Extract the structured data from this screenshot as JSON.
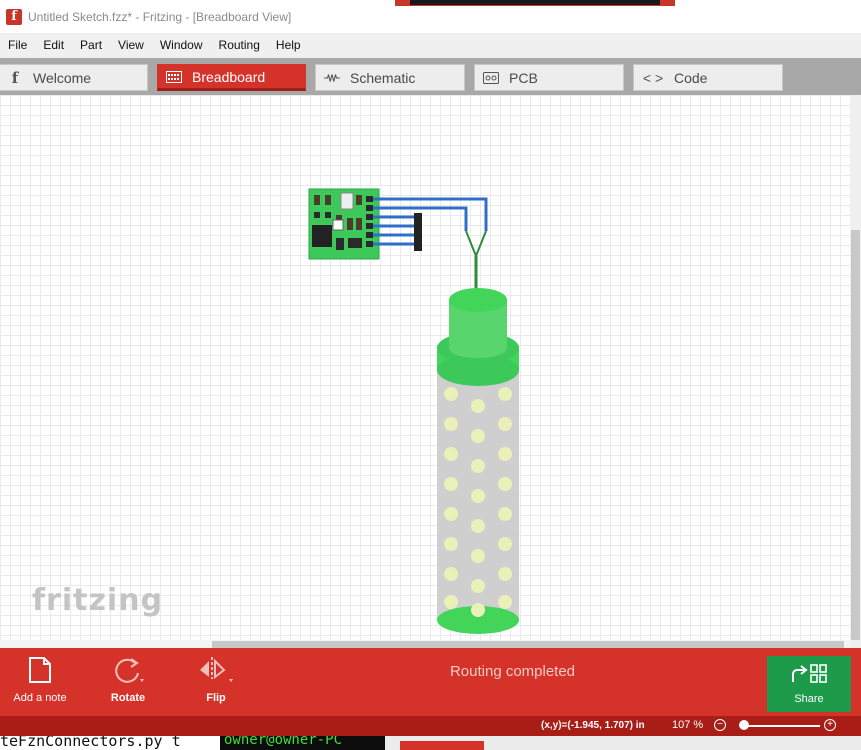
{
  "window": {
    "title": "Untitled Sketch.fzz* - Fritzing - [Breadboard View]",
    "app_icon": "fritzing-f-icon",
    "app_icon_glyph": "f"
  },
  "menu": [
    "File",
    "Edit",
    "Part",
    "View",
    "Window",
    "Routing",
    "Help"
  ],
  "tabs": [
    {
      "label": "Welcome",
      "icon": "fritzing-f-icon",
      "glyph": "f",
      "active": false
    },
    {
      "label": "Breadboard",
      "icon": "breadboard-icon",
      "active": true
    },
    {
      "label": "Schematic",
      "icon": "resistor-icon",
      "active": false
    },
    {
      "label": "PCB",
      "icon": "pcb-icon",
      "active": false
    },
    {
      "label": "Code",
      "icon": "code-brackets-icon",
      "glyph": "< >",
      "active": false
    }
  ],
  "canvas": {
    "watermark": "fritzing",
    "parts": [
      "sensor-module",
      "wire-bundle",
      "soil-probe"
    ]
  },
  "toolbar": {
    "add_note": "Add a note",
    "rotate": "Rotate",
    "flip": "Flip",
    "routing_status": "Routing completed",
    "share": "Share"
  },
  "statusbar": {
    "coords": "(x,y)=(-1.945, 1.707) in",
    "zoom": "107 %",
    "zoom_out": "−",
    "zoom_in": "+",
    "zoom_level_fraction": 0.05
  },
  "background": {
    "code_text": "teFznConnectors.py t",
    "terminal_text": "owner@owner-PC"
  },
  "colors": {
    "accent_red": "#d5322a",
    "share_green": "#1e9a4b",
    "board_green": "#3cc95a",
    "probe_gray": "#cfcfcf"
  }
}
